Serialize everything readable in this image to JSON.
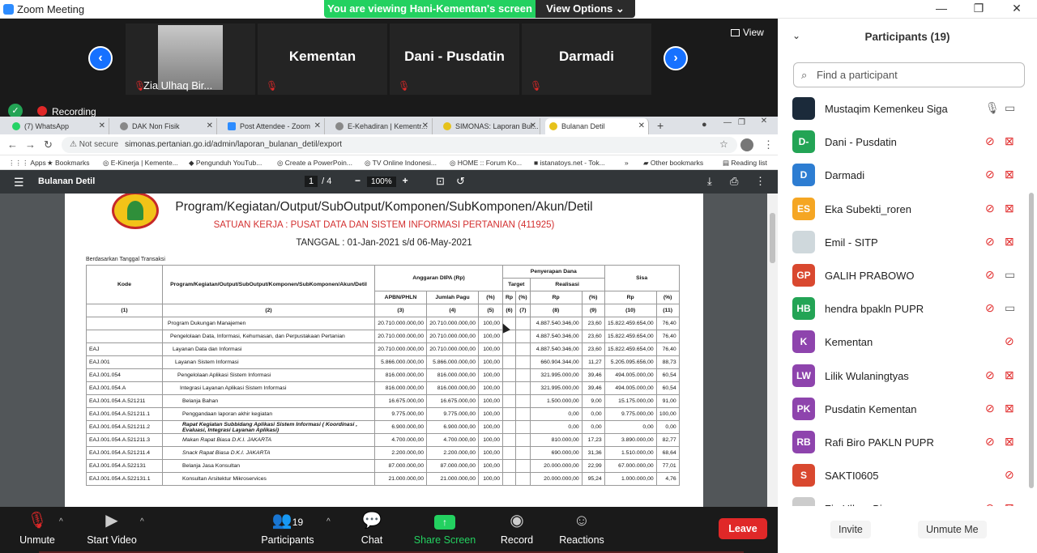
{
  "window": {
    "title": "Zoom Meeting",
    "viewing_banner": "You are viewing Hani-Kementan's screen",
    "view_options": "View Options",
    "controls": {
      "minimize": "—",
      "restore": "❐",
      "close": "✕"
    }
  },
  "gallery": {
    "tiles": [
      {
        "name": "Zia Ulhaq Bir..."
      },
      {
        "name": "Kementan"
      },
      {
        "name": "Dani - Pusdatin"
      },
      {
        "name": "Darmadi"
      }
    ],
    "view_label": "View"
  },
  "recording_label": "Recording",
  "browser": {
    "tabs": [
      {
        "label": "(7) WhatsApp"
      },
      {
        "label": "DAK Non Fisik"
      },
      {
        "label": "Post Attendee - Zoom"
      },
      {
        "label": "E-Kehadiran | Kementr..."
      },
      {
        "label": "SIMONAS: Laporan Bul..."
      },
      {
        "label": "Bulanan Detil"
      }
    ],
    "not_secure": "Not secure",
    "url": "simonas.pertanian.go.id/admin/laporan_bulanan_detil/export",
    "bookmarks": [
      "Apps",
      "Bookmarks",
      "E-Kinerja | Kemente...",
      "Pengunduh YouTub...",
      "Create a PowerPoin...",
      "TV Online Indonesi...",
      "HOME :: Forum Ko...",
      "istanatoys.net - Tok...",
      "»",
      "Other bookmarks",
      "Reading list"
    ]
  },
  "pdf": {
    "doc_title": "Bulanan Detil",
    "page_current": "1",
    "page_total": "/ 4",
    "zoom": "100%",
    "report_title": "Program/Kegiatan/Output/SubOutput/Komponen/SubKomponen/Akun/Detil",
    "satuan_kerja": "SATUAN KERJA : PUSAT DATA DAN SISTEM INFORMASI PERTANIAN (411925)",
    "tanggal": "TANGGAL : 01-Jan-2021 s/d 06-May-2021",
    "based_on": "Berdasarkan Tanggal Transaksi",
    "headers": {
      "kode": "Kode",
      "program": "Program/Kegiatan/Output/SubOutput/Komponen/SubKomponen/Akun/Detil",
      "anggaran": "Anggaran DIPA (Rp)",
      "penyerapan": "Penyerapan Dana",
      "sisa": "Sisa",
      "target": "Target",
      "realisasi": "Realisasi",
      "apbn": "APBN/PHLN",
      "jumlah_pagu": "Jumlah Pagu",
      "pct": "(%)",
      "rp": "Rp",
      "nums": [
        "(1)",
        "(2)",
        "(3)",
        "(4)",
        "(5)",
        "(6)",
        "(7)",
        "(8)",
        "(9)",
        "(10)",
        "(11)"
      ]
    },
    "rows": [
      [
        "",
        "Program Dukungan Manajemen",
        "20.710.000.000,00",
        "20.710.000.000,00",
        "100,00",
        "",
        "",
        "4.887.540.346,00",
        "23,60",
        "15.822.459.654,00",
        "76,40"
      ],
      [
        "",
        "Pengelolaan Data, Informasi, Kehumasan, dan Perpustakaan Pertanian",
        "20.710.000.000,00",
        "20.710.000.000,00",
        "100,00",
        "",
        "",
        "4.887.540.346,00",
        "23,60",
        "15.822.459.654,00",
        "76,40"
      ],
      [
        "EAJ",
        "Layanan Data dan Informasi",
        "20.710.000.000,00",
        "20.710.000.000,00",
        "100,00",
        "",
        "",
        "4.887.540.346,00",
        "23,60",
        "15.822.459.654,00",
        "76,40"
      ],
      [
        "EAJ.001",
        "Layanan Sistem Informasi",
        "5.866.000.000,00",
        "5.866.000.000,00",
        "100,00",
        "",
        "",
        "660.904.344,00",
        "11,27",
        "5.205.095.656,00",
        "88,73"
      ],
      [
        "EAJ.001.054",
        "Pengelolaan Aplikasi Sistem Informasi",
        "816.000.000,00",
        "816.000.000,00",
        "100,00",
        "",
        "",
        "321.995.000,00",
        "39,46",
        "494.005.000,00",
        "60,54"
      ],
      [
        "EAJ.001.054.A",
        "Integrasi Layanan Aplikasi Sistem Informasi",
        "816.000.000,00",
        "816.000.000,00",
        "100,00",
        "",
        "",
        "321.995.000,00",
        "39,46",
        "494.005.000,00",
        "60,54"
      ],
      [
        "EAJ.001.054.A.521211",
        "Belanja Bahan",
        "16.675.000,00",
        "16.675.000,00",
        "100,00",
        "",
        "",
        "1.500.000,00",
        "9,00",
        "15.175.000,00",
        "91,00"
      ],
      [
        "EAJ.001.054.A.521211.1",
        "Penggandaan laporan akhir kegiatan",
        "9.775.000,00",
        "9.775.000,00",
        "100,00",
        "",
        "",
        "0,00",
        "0,00",
        "9.775.000,00",
        "100,00"
      ],
      [
        "EAJ.001.054.A.521211.2",
        "Rapat Kegiatan Subbidang Aplikasi Sistem Informasi ( Koordinasi , Evaluasi, Integrasi Layanan Aplikasi)",
        "6.900.000,00",
        "6.900.000,00",
        "100,00",
        "",
        "",
        "0,00",
        "0,00",
        "0,00",
        "0,00"
      ],
      [
        "EAJ.001.054.A.521211.3",
        "Makan Rapat Biasa D.K.I. JAKARTA",
        "4.700.000,00",
        "4.700.000,00",
        "100,00",
        "",
        "",
        "810.000,00",
        "17,23",
        "3.890.000,00",
        "82,77"
      ],
      [
        "EAJ.001.054.A.521211.4",
        "Snack Rapat Biasa D.K.I. JAKARTA",
        "2.200.000,00",
        "2.200.000,00",
        "100,00",
        "",
        "",
        "690.000,00",
        "31,36",
        "1.510.000,00",
        "68,64"
      ],
      [
        "EAJ.001.054.A.522131",
        "Belanja Jasa Konsultan",
        "87.000.000,00",
        "87.000.000,00",
        "100,00",
        "",
        "",
        "20.000.000,00",
        "22,99",
        "67.000.000,00",
        "77,01"
      ],
      [
        "EAJ.001.054.A.522131.1",
        "Konsultan Arsitektur Mikroservices",
        "21.000.000,00",
        "21.000.000,00",
        "100,00",
        "",
        "",
        "20.000.000,00",
        "95,24",
        "1.000.000,00",
        "4,76"
      ]
    ]
  },
  "toolbar": {
    "unmute": "Unmute",
    "start_video": "Start Video",
    "participants": "Participants",
    "participants_count": "19",
    "chat": "Chat",
    "share_screen": "Share Screen",
    "record": "Record",
    "reactions": "Reactions",
    "leave": "Leave"
  },
  "panel": {
    "title": "Participants (19)",
    "search_placeholder": "Find a participant",
    "participants": [
      {
        "initials": "",
        "name": "Mustaqim Kemenkeu Siga",
        "color": "#1b2a3a",
        "mic": "on",
        "cam": "on"
      },
      {
        "initials": "D-",
        "name": "Dani - Pusdatin",
        "color": "#23a455",
        "mic": "muted",
        "cam": "off"
      },
      {
        "initials": "D",
        "name": "Darmadi",
        "color": "#2d7dd2",
        "mic": "muted",
        "cam": "off"
      },
      {
        "initials": "ES",
        "name": "Eka Subekti_roren",
        "color": "#f5a623",
        "mic": "muted",
        "cam": "off"
      },
      {
        "initials": "",
        "name": "Emil - SITP",
        "color": "#cfd8dc",
        "mic": "muted",
        "cam": "off"
      },
      {
        "initials": "GP",
        "name": "GALIH PRABOWO",
        "color": "#d9482f",
        "mic": "muted",
        "cam": "on"
      },
      {
        "initials": "HB",
        "name": "hendra bpakln PUPR",
        "color": "#23a455",
        "mic": "muted",
        "cam": "on"
      },
      {
        "initials": "K",
        "name": "Kementan",
        "color": "#8e44ad",
        "mic": "muted",
        "cam": ""
      },
      {
        "initials": "LW",
        "name": "Lilik Wulaningtyas",
        "color": "#8e44ad",
        "mic": "muted",
        "cam": "off"
      },
      {
        "initials": "PK",
        "name": "Pusdatin Kementan",
        "color": "#8e44ad",
        "mic": "muted",
        "cam": "off"
      },
      {
        "initials": "RB",
        "name": "Rafi Biro PAKLN PUPR",
        "color": "#8e44ad",
        "mic": "muted",
        "cam": "off"
      },
      {
        "initials": "S",
        "name": "SAKTI0605",
        "color": "#d9482f",
        "mic": "muted",
        "cam": ""
      },
      {
        "initials": "",
        "name": "Zia Ulhaq Bir...",
        "color": "#cccccc",
        "mic": "muted",
        "cam": "off"
      }
    ],
    "invite": "Invite",
    "unmute_me": "Unmute Me"
  }
}
